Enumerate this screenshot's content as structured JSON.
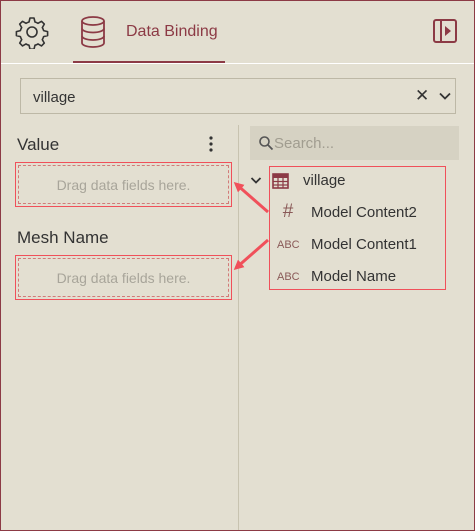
{
  "header": {
    "tab_label": "Data Binding",
    "icons": {
      "settings": "gear-icon",
      "data": "database-icon",
      "panel": "panel-collapse-icon"
    }
  },
  "dataset": {
    "selected": "village",
    "clear_symbol": "✕"
  },
  "value_section": {
    "title": "Value",
    "dropzone_hint": "Drag data fields here."
  },
  "mesh_section": {
    "title": "Mesh Name",
    "dropzone_hint": "Drag data fields here."
  },
  "search": {
    "placeholder": "Search..."
  },
  "tree": {
    "root": {
      "label": "village",
      "expanded": true
    },
    "fields": [
      {
        "label": "Model Content2",
        "type_glyph": "#",
        "type": "number"
      },
      {
        "label": "Model Content1",
        "type_glyph": "ABC",
        "type": "string"
      },
      {
        "label": "Model Name",
        "type_glyph": "ABC",
        "type": "string"
      }
    ]
  },
  "colors": {
    "accent": "#8c3a45",
    "highlight": "#f0505a",
    "background": "#e3dfd1"
  }
}
